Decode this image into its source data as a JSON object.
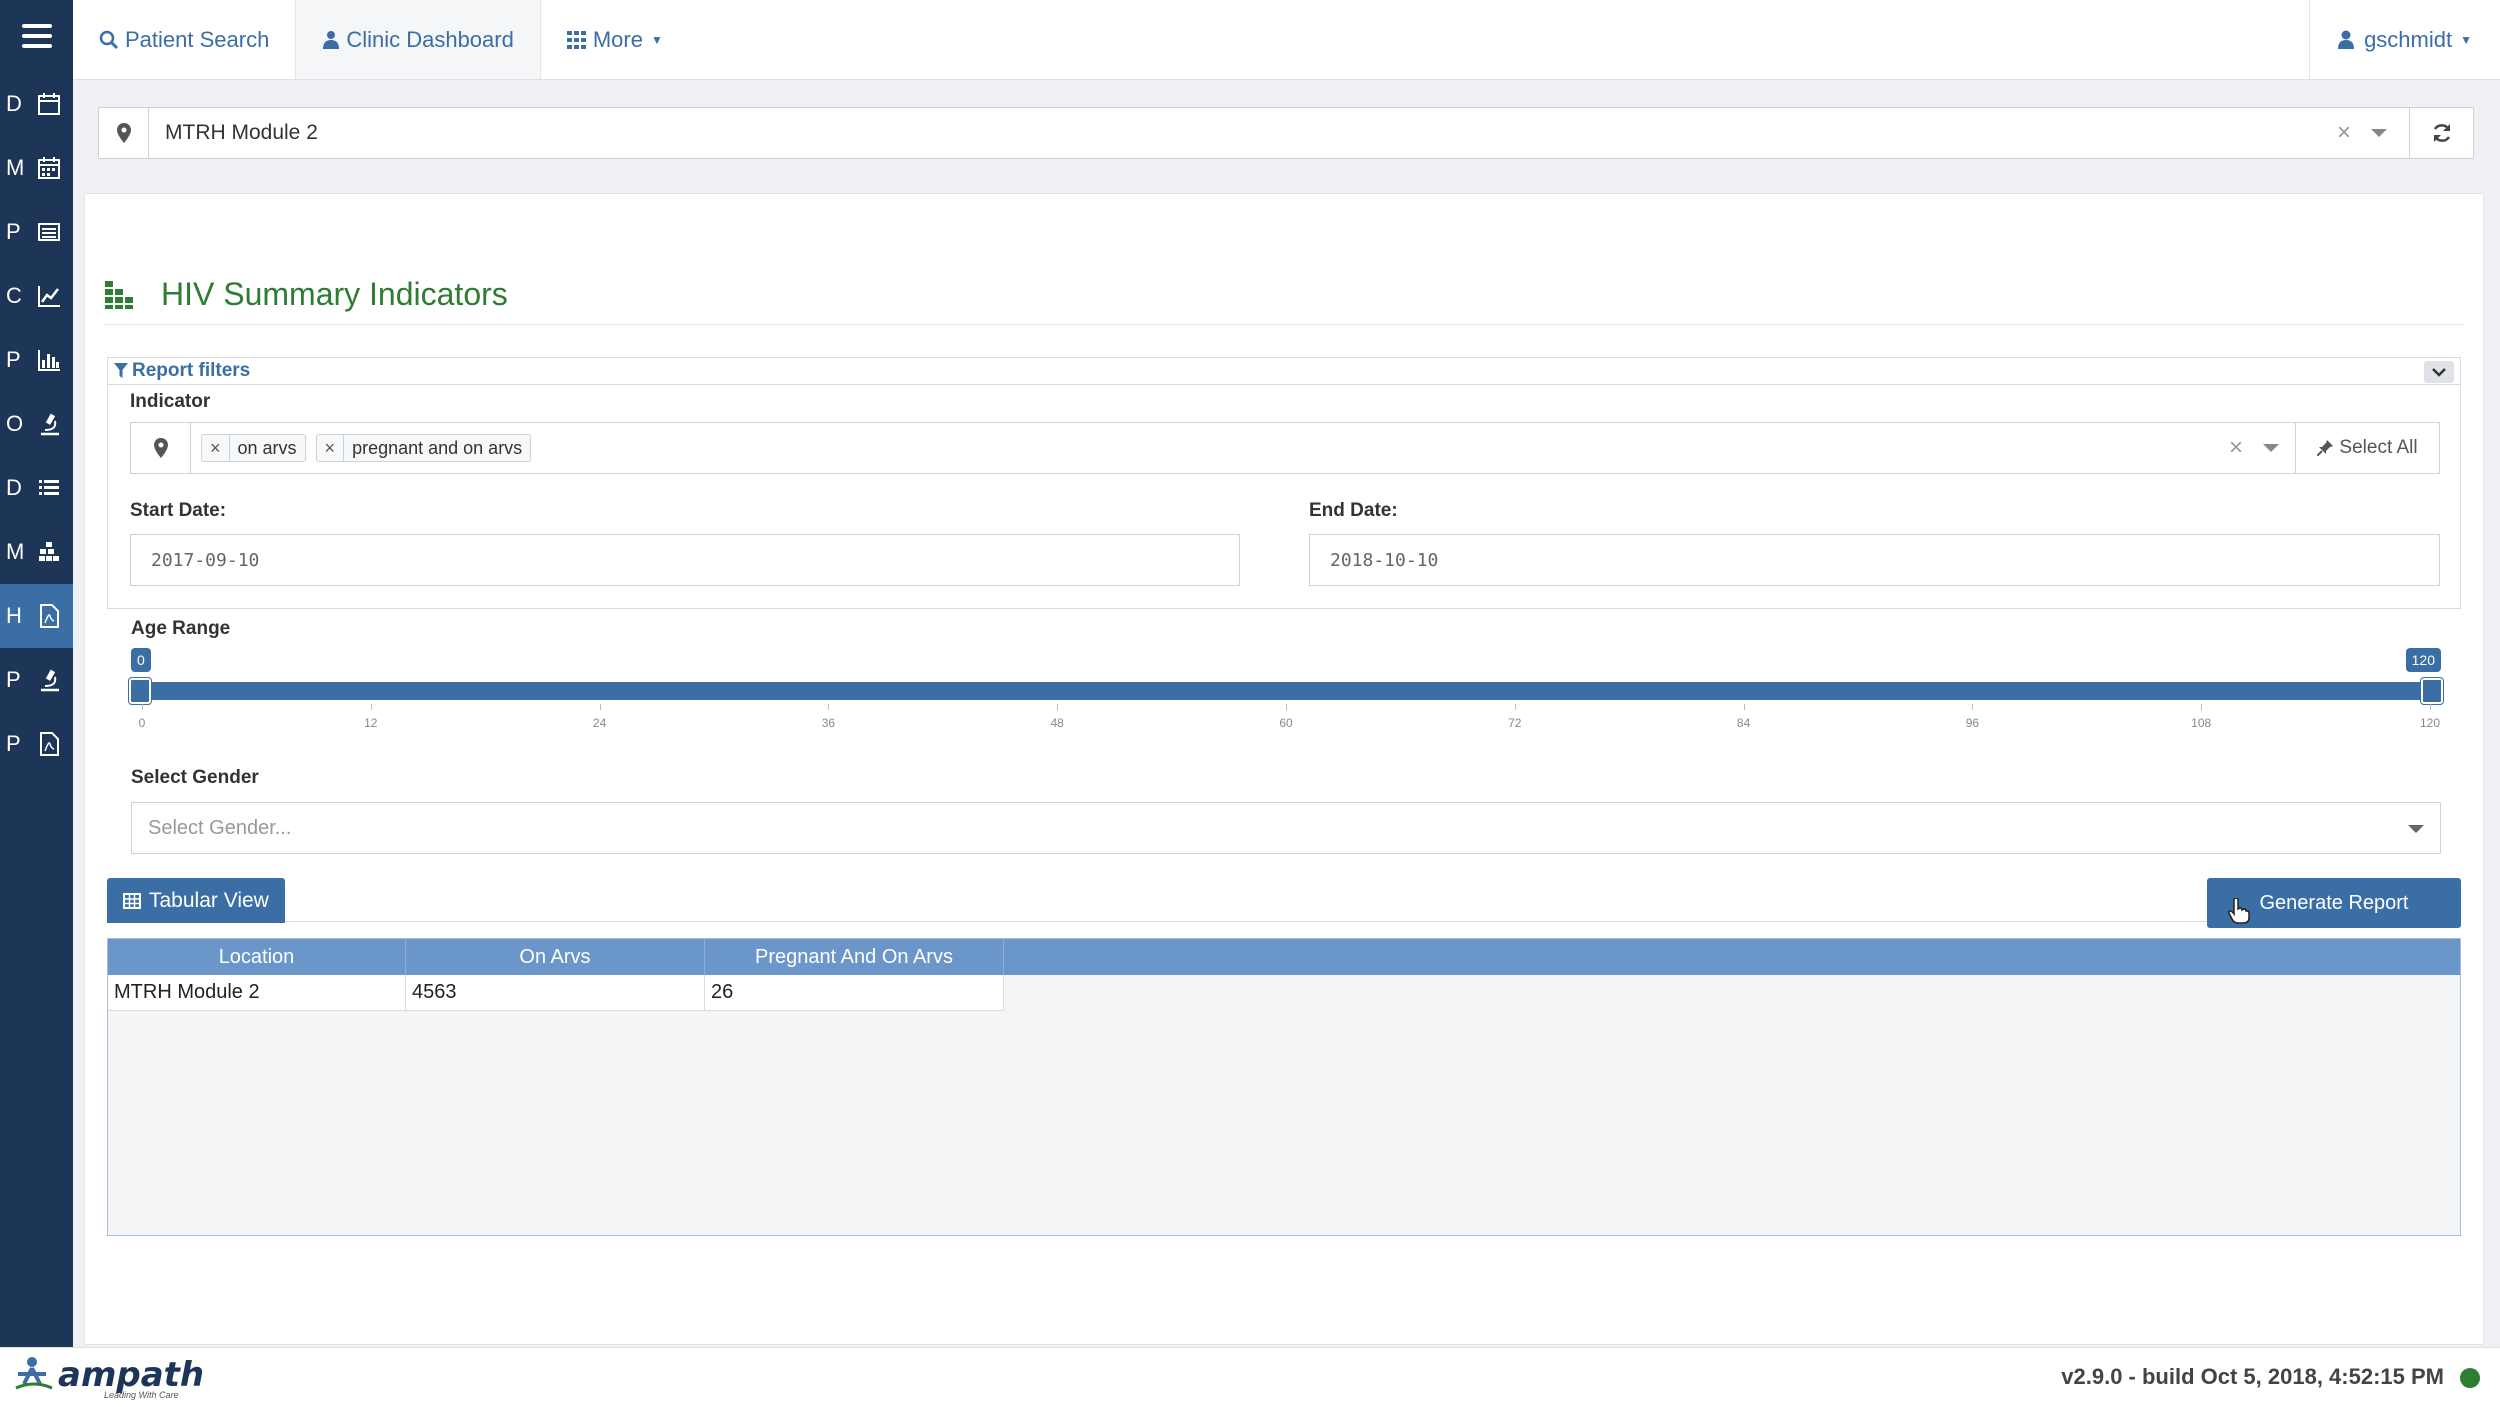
{
  "sidebar": {
    "items": [
      {
        "letter": "D",
        "icon": "calendar-icon"
      },
      {
        "letter": "M",
        "icon": "calendar-month-icon"
      },
      {
        "letter": "P",
        "icon": "list-alt-icon"
      },
      {
        "letter": "C",
        "icon": "line-chart-icon"
      },
      {
        "letter": "P",
        "icon": "bar-chart-icon"
      },
      {
        "letter": "O",
        "icon": "microscope-icon"
      },
      {
        "letter": "D",
        "icon": "list-icon"
      },
      {
        "letter": "M",
        "icon": "cubes-icon"
      },
      {
        "letter": "H",
        "icon": "pdf-file-icon"
      },
      {
        "letter": "P",
        "icon": "microscope-icon"
      },
      {
        "letter": "P",
        "icon": "pdf-file-icon"
      }
    ],
    "active_index": 8
  },
  "topnav": {
    "tabs": [
      {
        "label": "Patient Search",
        "icon": "search-icon"
      },
      {
        "label": "Clinic Dashboard",
        "icon": "user-md-icon"
      },
      {
        "label": "More",
        "icon": "grid-icon"
      }
    ],
    "active_tab": 1,
    "user": "gschmidt"
  },
  "location": {
    "value": "MTRH Module 2",
    "clear": "×"
  },
  "report": {
    "title": "HIV Summary Indicators",
    "filters_label": "Report filters",
    "indicator_label": "Indicator",
    "indicators": [
      "on arvs",
      "pregnant and on arvs"
    ],
    "indicator_clear": "×",
    "select_all": "Select All",
    "start_label": "Start Date:",
    "start_value": "2017-09-10",
    "end_label": "End Date:",
    "end_value": "2018-10-10",
    "age_label": "Age Range",
    "age_min": "0",
    "age_max": "120",
    "age_ticks": [
      "0",
      "12",
      "24",
      "36",
      "48",
      "60",
      "72",
      "84",
      "96",
      "108",
      "120"
    ],
    "gender_label": "Select Gender",
    "gender_placeholder": "Select Gender...",
    "tabular_view": "Tabular View",
    "generate": "Generate Report"
  },
  "table": {
    "columns": [
      "Location",
      "On Arvs",
      "Pregnant And On Arvs"
    ],
    "rows": [
      [
        "MTRH Module 2",
        "4563",
        "26"
      ]
    ]
  },
  "footer": {
    "brand": "ampath",
    "tagline": "Leading With Care",
    "version": "v2.9.0 - build Oct 5, 2018, 4:52:15 PM",
    "status_color": "#2e7d32"
  },
  "colors": {
    "accent": "#3a6ea5",
    "sidebar": "#1d3557",
    "title": "#2e7d32"
  }
}
